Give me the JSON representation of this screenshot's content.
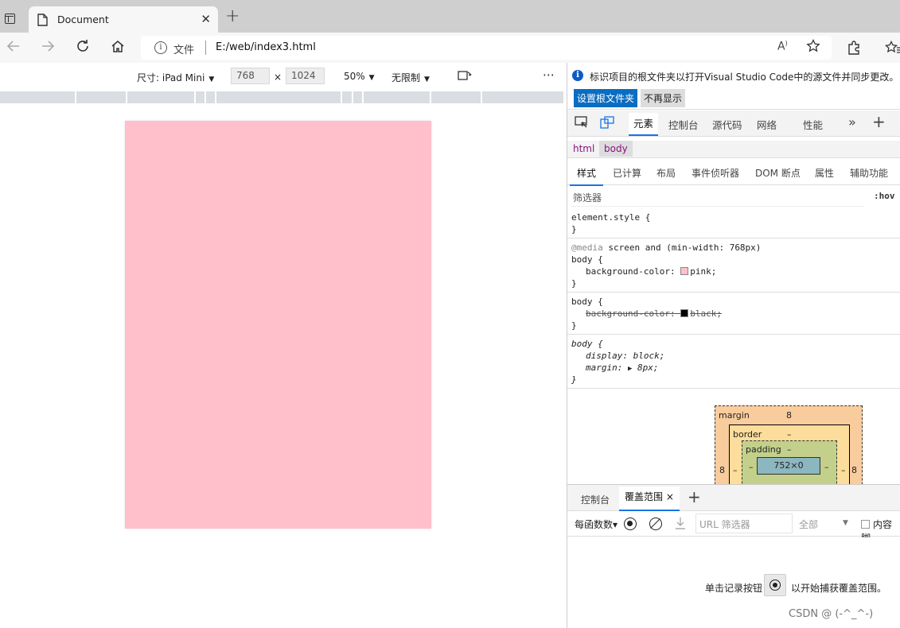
{
  "browser": {
    "tab_title": "Document",
    "tab_close": "✕",
    "new_tab": "+",
    "address_label": "文件",
    "url": "E:/web/index3.html"
  },
  "device_toolbar": {
    "dimensions_label": "尺寸: iPad Mini",
    "width": "768",
    "times": "×",
    "height": "1024",
    "zoom": "50%",
    "throttle": "无限制",
    "more": "⋯"
  },
  "devtools": {
    "info_message": "标识项目的根文件夹以打开Visual Studio Code中的源文件并同步更改。",
    "set_root_button": "设置根文件夹",
    "dont_show_button": "不再显示",
    "main_tabs": [
      "元素",
      "控制台",
      "源代码",
      "网络",
      "性能"
    ],
    "more_tabs": "»",
    "add_tab": "+",
    "breadcrumbs": [
      "html",
      "body"
    ],
    "sub_tabs": [
      "样式",
      "已计算",
      "布局",
      "事件侦听器",
      "DOM 断点",
      "属性",
      "辅助功能"
    ],
    "filter_placeholder": "筛选器",
    "hov": ":hov",
    "styles": {
      "rule1_selector": "element.style {",
      "rule1_close": "}",
      "rule2_media_at": "@media",
      "rule2_media_rest": " screen and (min-width: 768px)",
      "rule2_selector": "body {",
      "rule2_prop": "background-color:",
      "rule2_value": "pink;",
      "rule2_close": "}",
      "rule3_selector": "body {",
      "rule3_prop": "background-color:",
      "rule3_value": "black;",
      "rule3_close": "}",
      "rule4_selector": "body {",
      "rule4_prop1": "display:",
      "rule4_value1": "block;",
      "rule4_prop2": "margin:",
      "rule4_value2": "8px;",
      "rule4_close": "}"
    },
    "box_model": {
      "margin_label": "margin",
      "margin_value": "8",
      "border_label": "border",
      "border_value": "–",
      "padding_label": "padding",
      "padding_value": "–",
      "content": "752×0",
      "left_margin": "8",
      "right_margin": "8",
      "left_border": "–",
      "right_border": "–",
      "left_padding": "–",
      "right_padding": "–"
    },
    "drawer_tabs": [
      "控制台",
      "覆盖范围"
    ],
    "drawer_close": "×",
    "drawer_add": "+",
    "coverage": {
      "per_function": "每函数数▾",
      "url_filter_placeholder": "URL 筛选器",
      "type_all": "全部",
      "content_checkbox": "内容脚",
      "hint_before": "单击记录按钮",
      "hint_after": "以开始捕获覆盖范围。"
    },
    "watermark": "CSDN @ (-^_^-)"
  },
  "colors": {
    "page_background": "#ffc0cb",
    "accent": "#0a6dc2"
  }
}
